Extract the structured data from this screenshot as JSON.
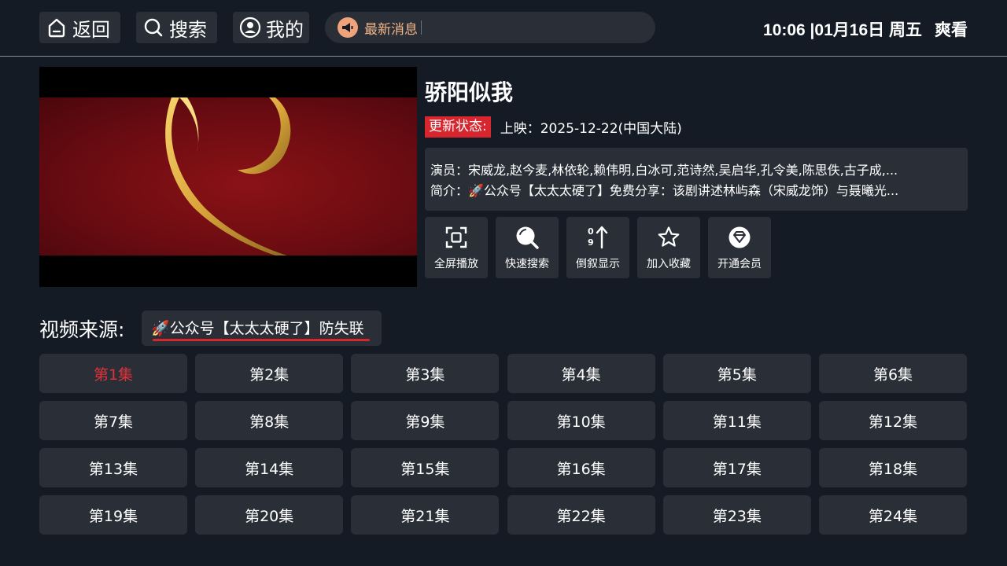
{
  "nav": {
    "back_label": "返回",
    "search_label": "搜索",
    "mine_label": "我的"
  },
  "news": {
    "text": "最新消息"
  },
  "clock": {
    "time_date": "10:06 |01月16日 周五",
    "app_name": "爽看"
  },
  "video": {
    "title": "骄阳似我",
    "status_label": "更新状态:",
    "release": "上映：2025-12-22(中国大陆)",
    "cast": "演员：宋威龙,赵今麦,林依轮,赖伟明,白冰可,范诗然,吴启华,孔令美,陈思佚,古子成,...",
    "intro": "简介：🚀公众号【太太太硬了】免费分享：该剧讲述林屿森（宋威龙饰）与聂曦光..."
  },
  "actions": [
    {
      "label": "全屏播放",
      "icon": "fullscreen-icon"
    },
    {
      "label": "快速搜索",
      "icon": "search-icon"
    },
    {
      "label": "倒叙显示",
      "icon": "sort-icon"
    },
    {
      "label": "加入收藏",
      "icon": "star-icon"
    },
    {
      "label": "开通会员",
      "icon": "diamond-icon"
    }
  ],
  "source": {
    "label": "视频来源:",
    "tab": "🚀公众号【太太太硬了】防失联"
  },
  "episodes": [
    "第1集",
    "第2集",
    "第3集",
    "第4集",
    "第5集",
    "第6集",
    "第7集",
    "第8集",
    "第9集",
    "第10集",
    "第11集",
    "第12集",
    "第13集",
    "第14集",
    "第15集",
    "第16集",
    "第17集",
    "第18集",
    "第19集",
    "第20集",
    "第21集",
    "第22集",
    "第23集",
    "第24集"
  ],
  "colors": {
    "accent": "#d7262e",
    "tile": "#2a2f37",
    "background": "#141b25"
  }
}
